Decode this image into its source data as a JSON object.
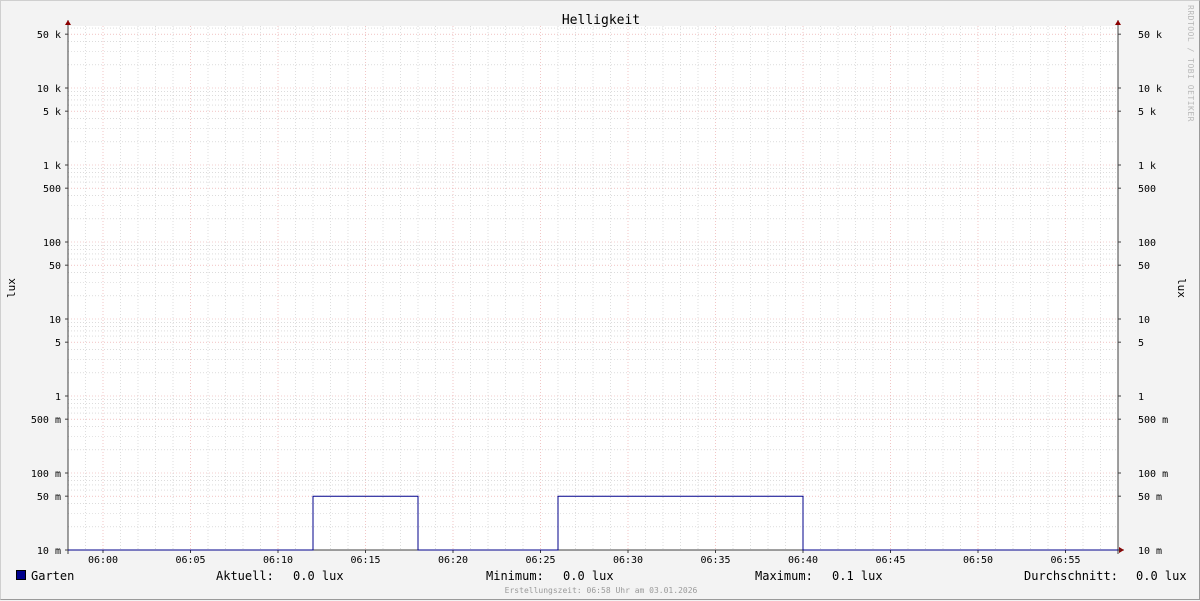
{
  "chart_data": {
    "type": "line",
    "title": "Helligkeit",
    "ylabel_left": "lux",
    "ylabel_right": "lux",
    "y_scale": "log",
    "ylim": [
      0.01,
      70000
    ],
    "y_ticks": [
      {
        "value": 0.01,
        "label": "10 m"
      },
      {
        "value": 0.05,
        "label": "50 m"
      },
      {
        "value": 0.1,
        "label": "100 m"
      },
      {
        "value": 0.5,
        "label": "500 m"
      },
      {
        "value": 1,
        "label": "1"
      },
      {
        "value": 5,
        "label": "5"
      },
      {
        "value": 10,
        "label": "10"
      },
      {
        "value": 50,
        "label": "50"
      },
      {
        "value": 100,
        "label": "100"
      },
      {
        "value": 500,
        "label": "500"
      },
      {
        "value": 1000,
        "label": "1 k"
      },
      {
        "value": 5000,
        "label": "5 k"
      },
      {
        "value": 10000,
        "label": "10 k"
      },
      {
        "value": 50000,
        "label": "50 k"
      }
    ],
    "x_ticks": [
      "06:00",
      "06:05",
      "06:10",
      "06:15",
      "06:20",
      "06:25",
      "06:30",
      "06:35",
      "06:40",
      "06:45",
      "06:50",
      "06:55"
    ],
    "xlim": [
      "05:58",
      "06:58"
    ],
    "grid": true,
    "series": [
      {
        "name": "Garten",
        "color": "#00008b",
        "points": [
          {
            "x": "05:58",
            "y": 0.01
          },
          {
            "x": "06:12",
            "y": 0.01
          },
          {
            "x": "06:12",
            "y": 0.05
          },
          {
            "x": "06:18",
            "y": 0.05
          },
          {
            "x": "06:18",
            "y": 0.01
          },
          {
            "x": "06:26",
            "y": 0.01
          },
          {
            "x": "06:26",
            "y": 0.05
          },
          {
            "x": "06:40",
            "y": 0.05
          },
          {
            "x": "06:40",
            "y": 0.01
          },
          {
            "x": "06:58",
            "y": 0.01
          }
        ]
      }
    ]
  },
  "legend": {
    "name": "Garten",
    "current_label": "Aktuell:",
    "current_value": "0.0 lux",
    "min_label": "Minimum:",
    "min_value": "0.0 lux",
    "max_label": "Maximum:",
    "max_value": "0.1 lux",
    "avg_label": "Durchschnitt:",
    "avg_value": "0.0 lux"
  },
  "footer": "Erstellungszeit: 06:58 Uhr am 03.01.2026",
  "watermark": "RRDTOOL / TOBI OETIKER",
  "colors": {
    "major_grid": "#e8a0a0",
    "minor_grid": "#c8c8c8",
    "axis": "#404040",
    "arrow": "#8b0000",
    "series": "#00008b"
  }
}
